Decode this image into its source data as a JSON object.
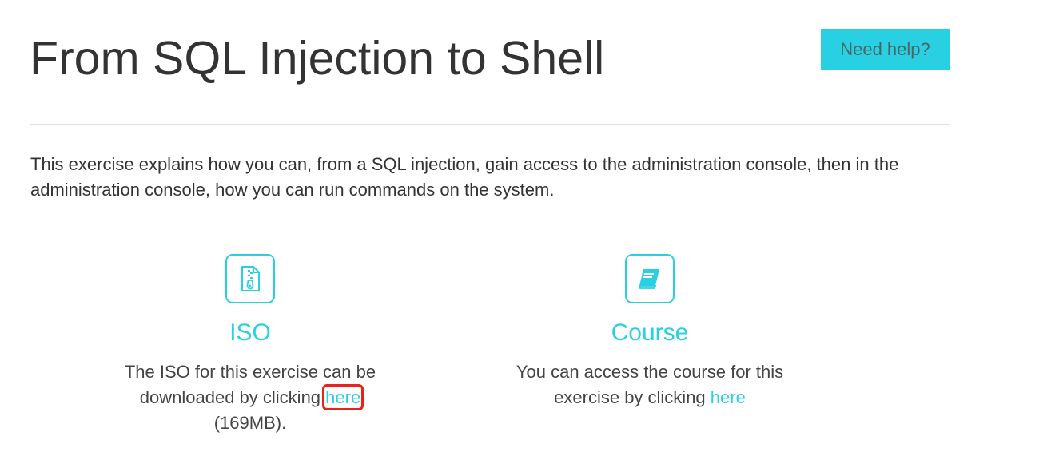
{
  "page": {
    "title": "From SQL Injection to Shell",
    "help_button": "Need help?",
    "intro": "This exercise explains how you can, from a SQL injection, gain access to the administration console, then in the administration console, how you can run commands on the system."
  },
  "features": {
    "iso": {
      "icon": "zip-file-icon",
      "title": "ISO",
      "text_before": "The ISO for this exercise can be downloaded by clicking ",
      "link": "here",
      "text_after": " (169MB)."
    },
    "course": {
      "icon": "book-icon",
      "title": "Course",
      "text_before": "You can access the course for this exercise by clicking ",
      "link": "here"
    }
  },
  "colors": {
    "accent": "#29d0e2",
    "highlight": "#e8231b",
    "text": "#333333"
  }
}
